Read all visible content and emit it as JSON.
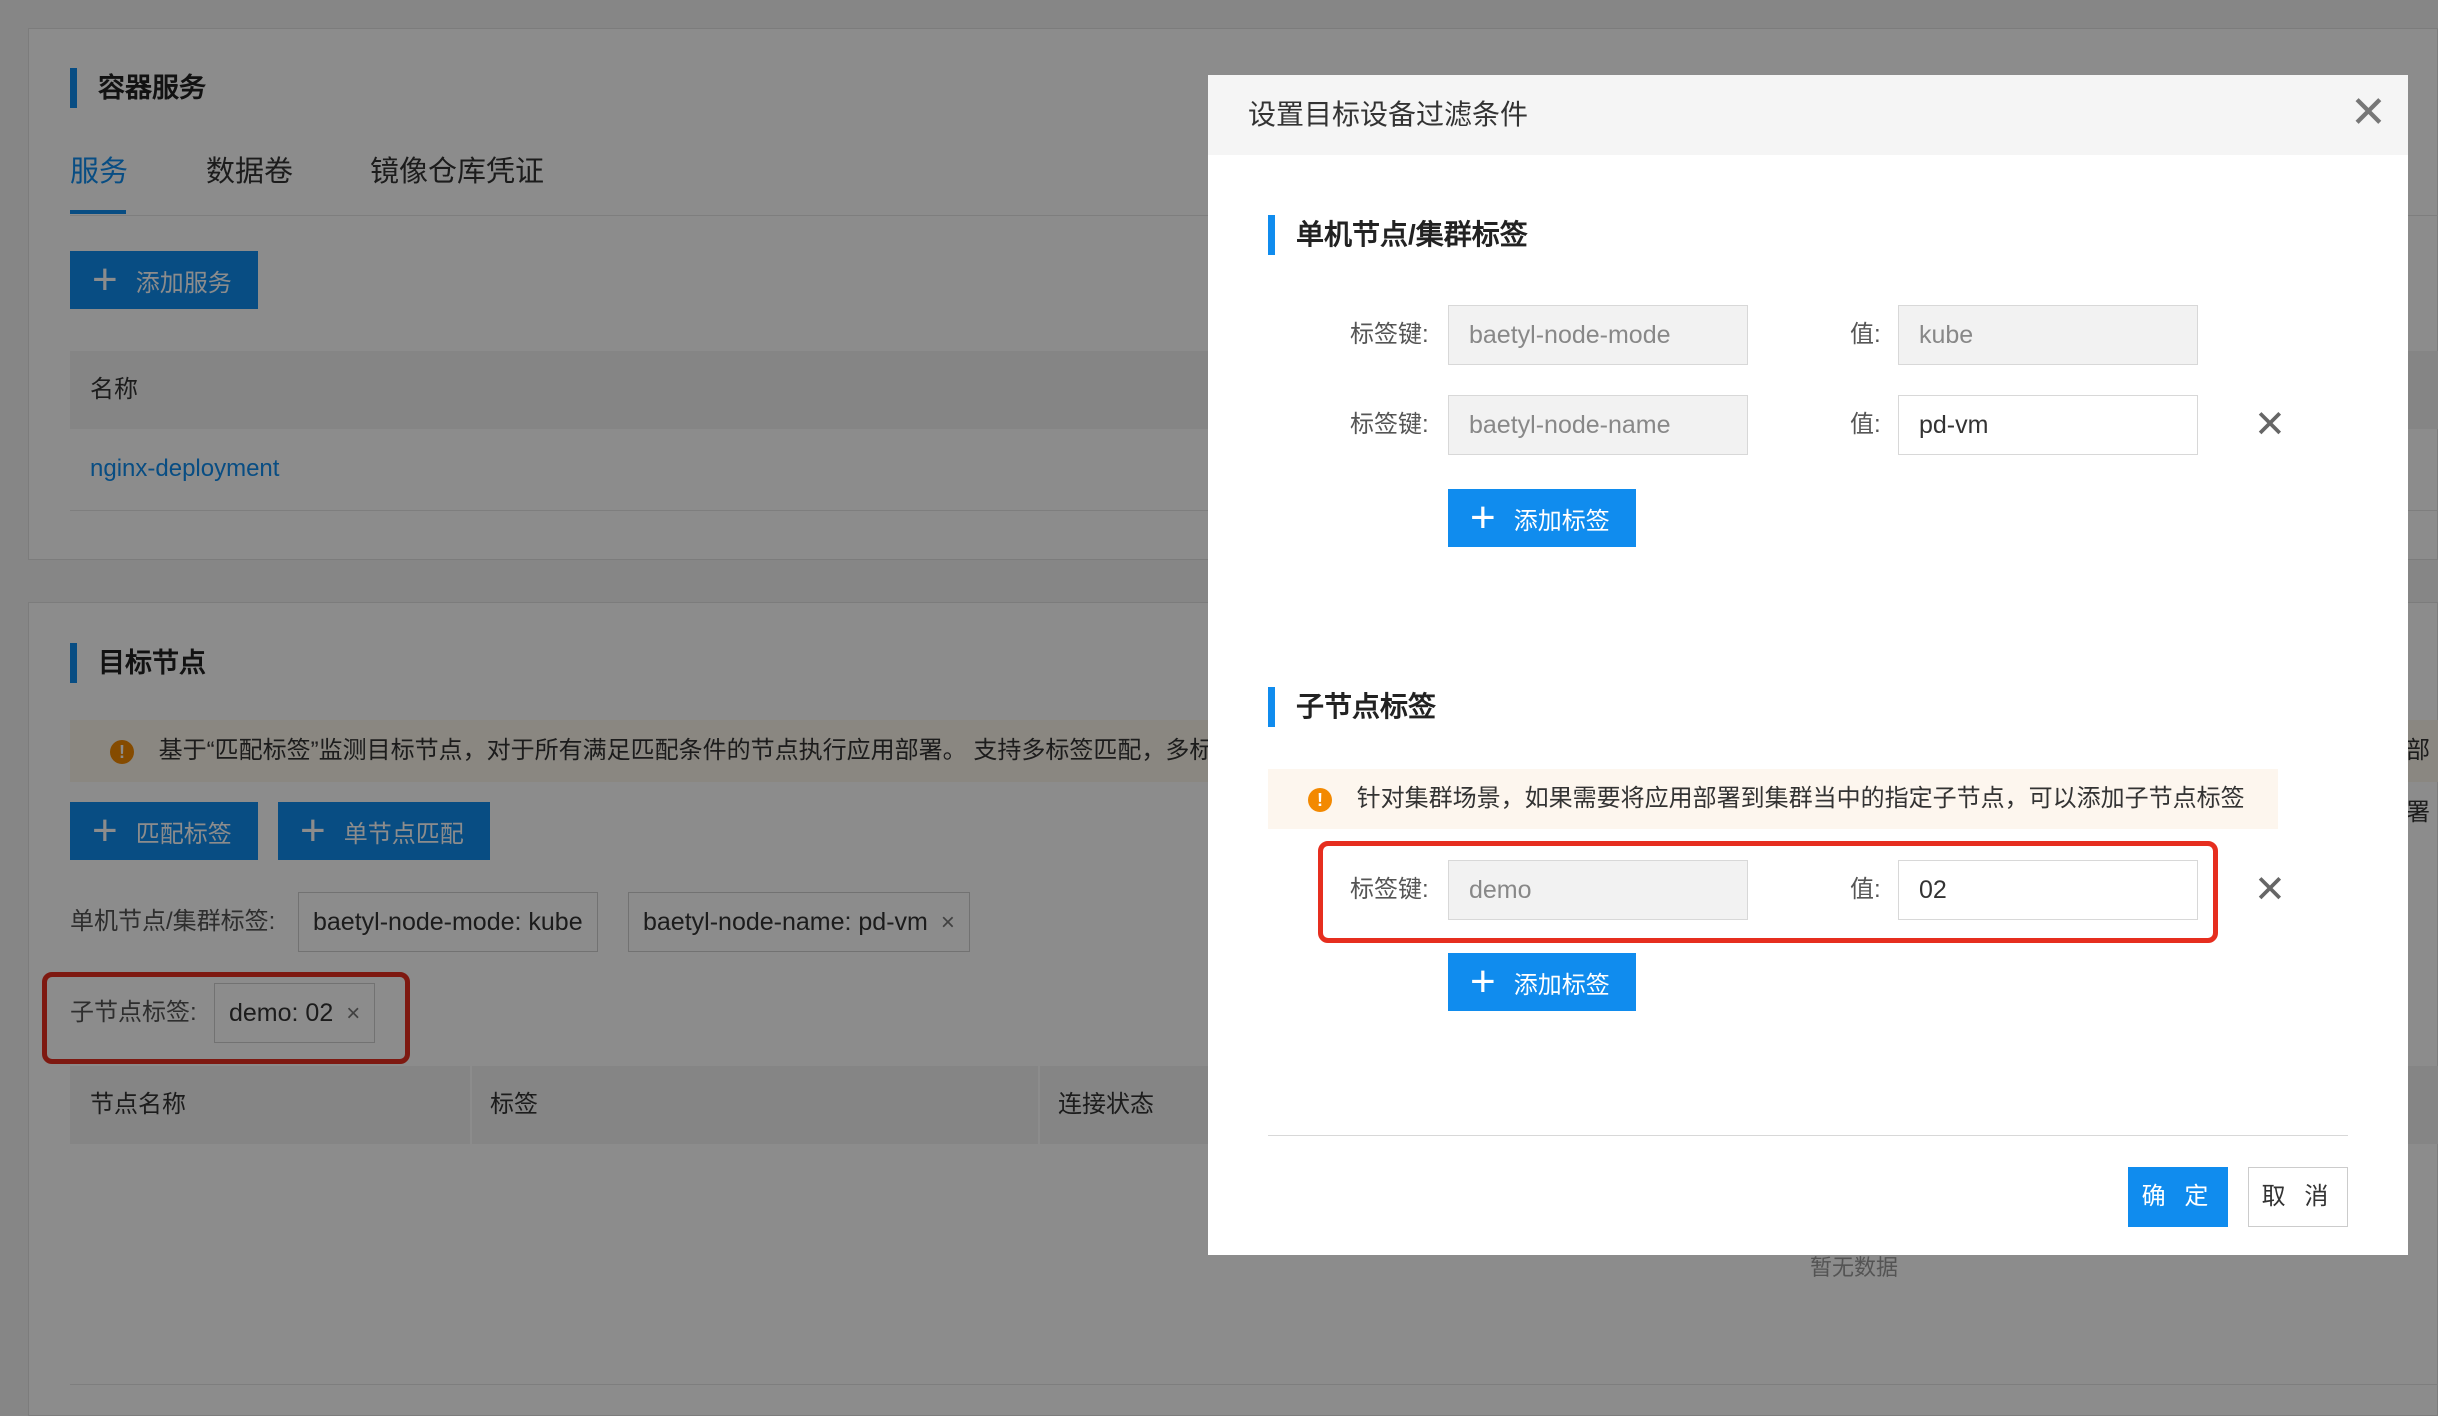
{
  "container_service": {
    "title": "容器服务",
    "tabs": [
      "服务",
      "数据卷",
      "镜像仓库凭证"
    ],
    "add_button": "添加服务",
    "table_header_name": "名称",
    "rows": [
      "nginx-deployment"
    ]
  },
  "target_nodes": {
    "title": "目标节点",
    "notice": "基于“匹配标签”监测目标节点，对于所有满足匹配条件的节点执行应用部署。 支持多标签匹配，多标",
    "notice_right": "部署",
    "match_label_button": "匹配标签",
    "single_node_button": "单节点匹配",
    "single_cluster_label": "单机节点/集群标签:",
    "single_cluster_tags": [
      "baetyl-node-mode: kube",
      "baetyl-node-name: pd-vm"
    ],
    "child_label": "子节点标签:",
    "child_tags": [
      "demo: 02"
    ],
    "table_headers": [
      "节点名称",
      "标签",
      "连接状态"
    ],
    "empty_text": "暂无数据"
  },
  "dialog": {
    "title": "设置目标设备过滤条件",
    "section1_title": "单机节点/集群标签",
    "key_label": "标签键:",
    "value_label": "值:",
    "section1_rows": [
      {
        "key": "baetyl-node-mode",
        "value": "kube"
      },
      {
        "key": "baetyl-node-name",
        "value": "pd-vm"
      }
    ],
    "add_label_button": "添加标签",
    "section2_title": "子节点标签",
    "section2_notice": "针对集群场景，如果需要将应用部署到集群当中的指定子节点，可以添加子节点标签",
    "section2_rows": [
      {
        "key": "demo",
        "value": "02"
      }
    ],
    "confirm_button": "确 定",
    "cancel_button": "取 消"
  },
  "icons": {
    "plus": "plus-icon",
    "close": "close-icon",
    "warning": "warning-icon"
  },
  "colors": {
    "primary": "#108cee",
    "highlight": "#e62e1f",
    "warning": "#f38900"
  }
}
